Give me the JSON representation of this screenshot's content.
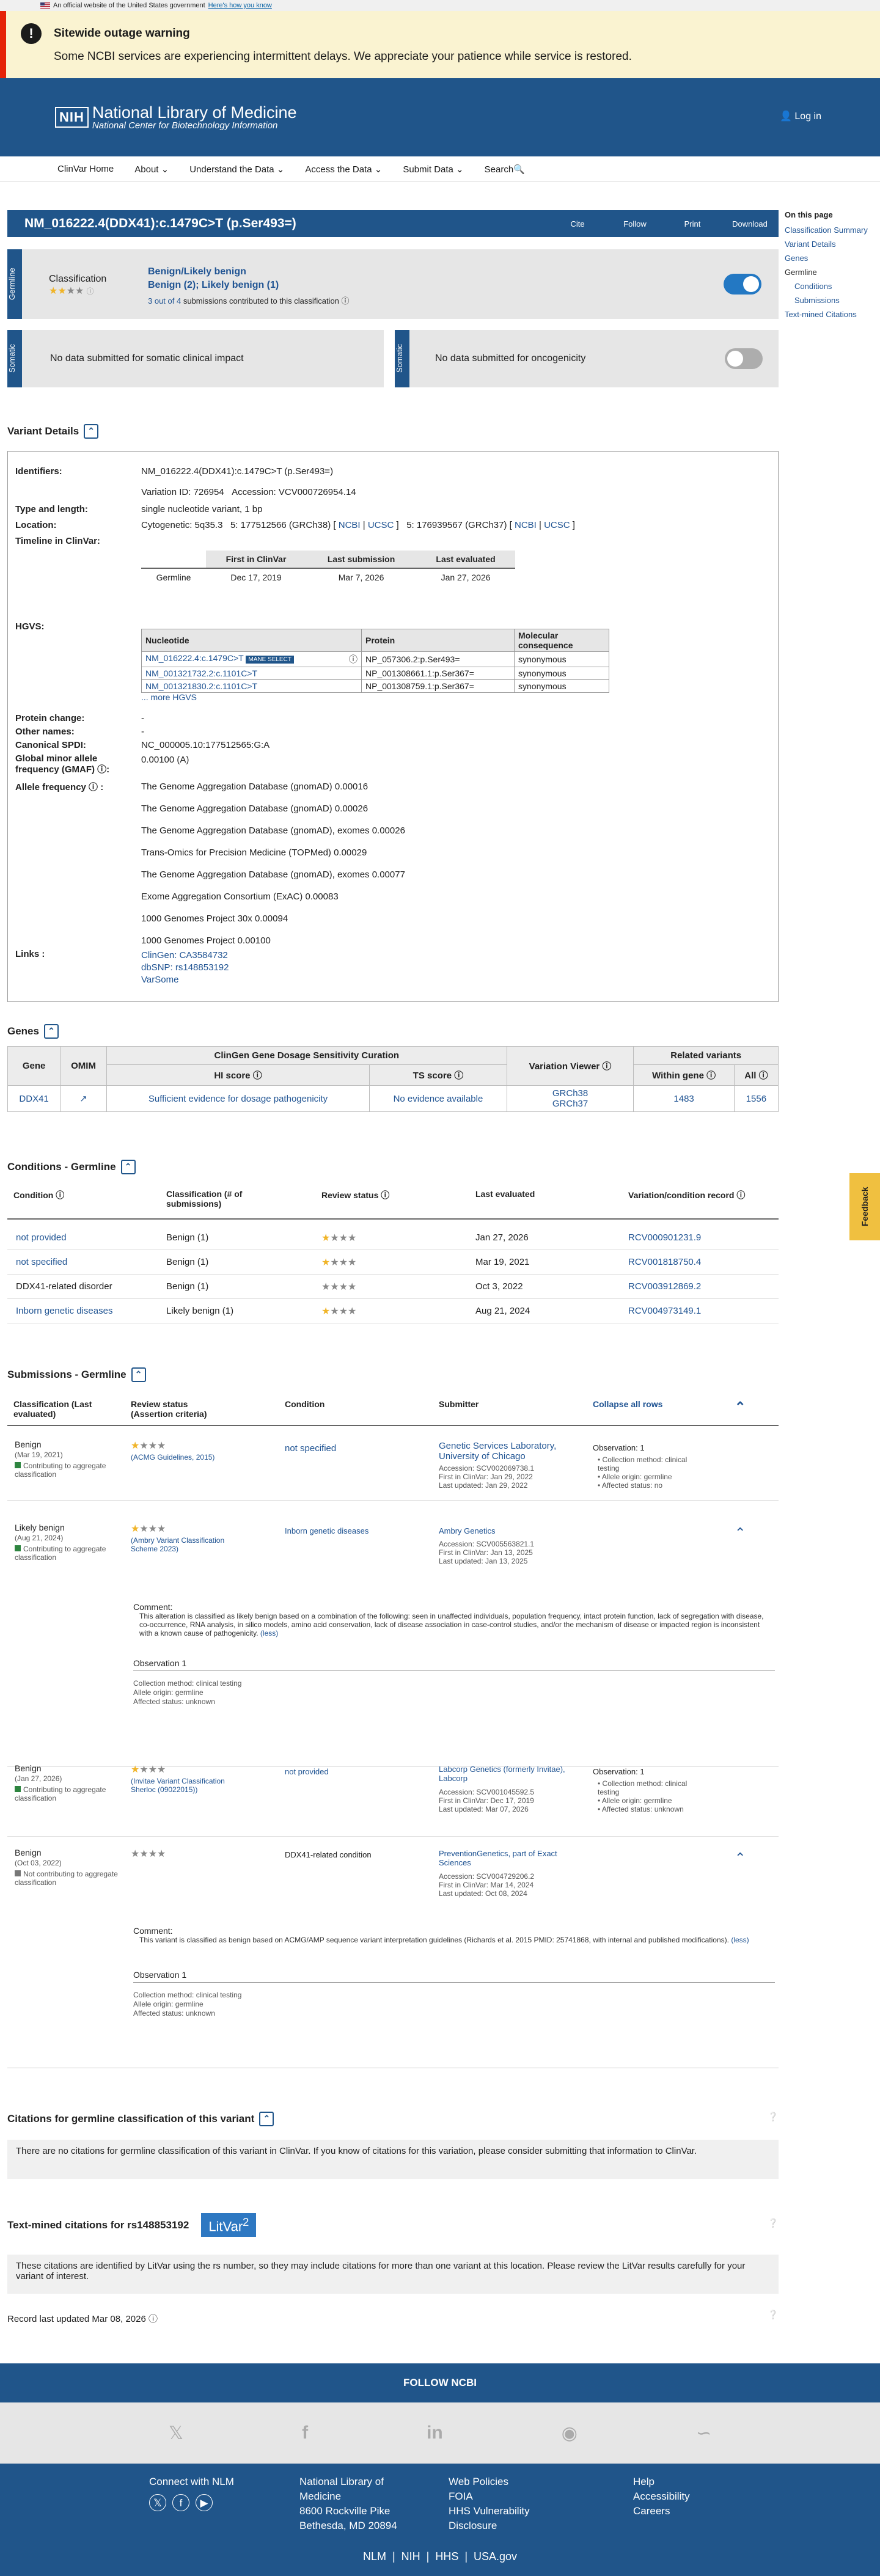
{
  "gov_banner": {
    "text": "An official website of the United States government",
    "link": "Here's how you know"
  },
  "alert": {
    "title": "Sitewide outage warning",
    "body": "Some NCBI services are experiencing intermittent delays. We appreciate your patience while service is restored."
  },
  "header": {
    "logo_abbr": "NIH",
    "title": "National Library of Medicine",
    "subtitle": "National Center for Biotechnology Information",
    "login": "Log in"
  },
  "nav": [
    "ClinVar Home",
    "About",
    "Understand the Data",
    "Access the Data",
    "Submit Data",
    "Search"
  ],
  "variant": {
    "title": "NM_016222.4(DDX41):c.1479C>T (p.Ser493=)",
    "actions": [
      "Cite",
      "Follow",
      "Print",
      "Download"
    ]
  },
  "onthispage": {
    "heading": "On this page",
    "items": [
      "Classification Summary",
      "Variant Details",
      "Genes",
      "Germline",
      "Conditions",
      "Submissions",
      "Text-mined Citations"
    ]
  },
  "germline": {
    "label": "Germline",
    "classification_label": "Classification",
    "class1": "Benign/Likely benign",
    "class2": "Benign (2); Likely benign (1)",
    "submissions_text": "3 out of 4",
    "submissions_rest": "submissions contributed to this classification"
  },
  "somatic": {
    "label": "Somatic",
    "left": "No data submitted for somatic clinical impact",
    "right": "No data submitted for oncogenicity"
  },
  "details": {
    "heading": "Variant Details",
    "labels": {
      "identifiers": "Identifiers:",
      "type": "Type and length:",
      "location": "Location:",
      "timeline": "Timeline in ClinVar:",
      "hgvs": "HGVS:",
      "protein_change": "Protein change:",
      "other_names": "Other names:",
      "spdi": "Canonical SPDI:",
      "gmaf": "Global minor allele frequency (GMAF)",
      "af": "Allele frequency",
      "links": "Links :"
    },
    "identifier": "NM_016222.4(DDX41):c.1479C>T (p.Ser493=)",
    "variation_id": "Variation ID: 726954",
    "accession": "Accession: VCV000726954.14",
    "type": "single nucleotide variant, 1 bp",
    "cytogenetic": "Cytogenetic: 5q35.3",
    "loc38": "5: 177512566 (GRCh38) [",
    "loc37": "5: 176939567 (GRCh37) [",
    "ncbi": "NCBI",
    "ucsc": "UCSC",
    "timeline_headers": [
      "First in ClinVar",
      "Last submission",
      "Last evaluated"
    ],
    "timeline_row": [
      "Germline",
      "Dec 17, 2019",
      "Mar 7, 2026",
      "Jan 27, 2026"
    ],
    "hgvs_headers": [
      "Nucleotide",
      "Protein",
      "Molecular consequence"
    ],
    "hgvs_rows": [
      [
        "NM_016222.4:c.1479C>T",
        "NP_057306.2:p.Ser493=",
        "synonymous"
      ],
      [
        "NM_001321732.2:c.1101C>T",
        "NP_001308661.1:p.Ser367=",
        "synonymous"
      ],
      [
        "NM_001321830.2:c.1101C>T",
        "NP_001308759.1:p.Ser367=",
        "synonymous"
      ]
    ],
    "mane": "MANE SELECT",
    "more_hgvs": "... more HGVS",
    "protein_change": "-",
    "other_names": "-",
    "spdi": "NC_000005.10:177512565:G:A",
    "gmaf": "0.00100 (A)",
    "freqs": [
      "The Genome Aggregation Database (gnomAD) 0.00016",
      "The Genome Aggregation Database (gnomAD) 0.00026",
      "The Genome Aggregation Database (gnomAD), exomes 0.00026",
      "Trans-Omics for Precision Medicine (TOPMed) 0.00029",
      "The Genome Aggregation Database (gnomAD), exomes 0.00077",
      "Exome Aggregation Consortium (ExAC) 0.00083",
      "1000 Genomes Project 30x 0.00094",
      "1000 Genomes Project 0.00100"
    ],
    "links": [
      "ClinGen: CA3584732",
      "dbSNP: rs148853192",
      "VarSome"
    ]
  },
  "genes": {
    "heading": "Genes",
    "headers": {
      "gene": "Gene",
      "omim": "OMIM",
      "clingen": "ClinGen Gene Dosage Sensitivity Curation",
      "hi": "HI score",
      "ts": "TS score",
      "viewer": "Variation Viewer",
      "related": "Related variants",
      "within": "Within gene",
      "all": "All"
    },
    "row": {
      "gene": "DDX41",
      "hi": "Sufficient evidence for dosage pathogenicity",
      "ts": "No evidence available",
      "grch38": "GRCh38",
      "grch37": "GRCh37",
      "within": "1483",
      "all": "1556"
    }
  },
  "conditions": {
    "heading": "Conditions - Germline",
    "headers": [
      "Condition",
      "Classification (# of submissions)",
      "Review status",
      "Last evaluated",
      "Variation/condition record"
    ],
    "rows": [
      [
        "not provided",
        "Benign (1)",
        "Jan 27, 2026",
        "RCV000901231.9"
      ],
      [
        "not specified",
        "Benign (1)",
        "Mar 19, 2021",
        "RCV001818750.4"
      ],
      [
        "DDX41-related disorder",
        "Benign (1)",
        "Oct 3, 2022",
        "RCV003912869.2"
      ],
      [
        "Inborn genetic diseases",
        "Likely benign (1)",
        "Aug 21, 2024",
        "RCV004973149.1"
      ]
    ]
  },
  "submissions": {
    "heading": "Submissions - Germline",
    "headers": [
      "Classification (Last evaluated)",
      "Review status (Assertion criteria)",
      "Condition",
      "Submitter",
      "Collapse all rows"
    ],
    "contrib": "Contributing to aggregate classification",
    "notcontrib": "Not contributing to aggregate classification",
    "s1": {
      "cls": "Benign",
      "date": "(Mar 19, 2021)",
      "crit": "(ACMG Guidelines, 2015)",
      "cond": "not specified",
      "sub": "Genetic Services Laboratory, University of Chicago",
      "acc": "Accession: SCV002069738.1",
      "first": "First in ClinVar: Jan 29, 2022",
      "upd": "Last updated: Jan 29, 2022",
      "obs": "Observation: 1",
      "o1": "Collection method: clinical testing",
      "o2": "Allele origin: germline",
      "o3": "Affected status: no"
    },
    "s2": {
      "cls": "Likely benign",
      "date": "(Aug 21, 2024)",
      "crit": "(Ambry Variant Classification Scheme 2023)",
      "cond": "Inborn genetic diseases",
      "sub": "Ambry Genetics",
      "acc": "Accession: SCV005563821.1",
      "first": "First in ClinVar: Jan 13, 2025",
      "upd": "Last updated: Jan 13, 2025",
      "comment_h": "Comment:",
      "comment": "This alteration is classified as likely benign based on a combination of the following: seen in unaffected individuals, population frequency, intact protein function, lack of segregation with disease, co-occurrence, RNA analysis, in silico models, amino acid conservation, lack of disease association in case-control studies, and/or the mechanism of disease or impacted region is inconsistent with a known cause of pathogenicity.",
      "less": "(less)",
      "obs": "Observation 1",
      "o1": "Collection method: clinical testing",
      "o2": "Allele origin: germline",
      "o3": "Affected status: unknown"
    },
    "s3": {
      "cls": "Benign",
      "date": "(Jan 27, 2026)",
      "crit": "(Invitae Variant Classification Sherloc (09022015))",
      "cond": "not provided",
      "sub": "Labcorp Genetics (formerly Invitae), Labcorp",
      "acc": "Accession: SCV001045592.5",
      "first": "First in ClinVar: Dec 17, 2019",
      "upd": "Last updated: Mar 07, 2026",
      "obs": "Observation: 1",
      "o1": "Collection method: clinical testing",
      "o2": "Allele origin: germline",
      "o3": "Affected status: unknown"
    },
    "s4": {
      "cls": "Benign",
      "date": "(Oct 03, 2022)",
      "cond": "DDX41-related condition",
      "sub": "PreventionGenetics, part of Exact Sciences",
      "acc": "Accession: SCV004729206.2",
      "first": "First in ClinVar: Mar 14, 2024",
      "upd": "Last updated: Oct 08, 2024",
      "comment_h": "Comment:",
      "comment": "This variant is classified as benign based on ACMG/AMP sequence variant interpretation guidelines (Richards et al. 2015 PMID: 25741868, with internal and published modifications).",
      "less": "(less)",
      "obs": "Observation 1",
      "o1": "Collection method: clinical testing",
      "o2": "Allele origin: germline",
      "o3": "Affected status: unknown"
    }
  },
  "citations": {
    "heading": "Citations for germline classification of this variant",
    "text": "There are no citations for germline classification of this variant in ClinVar. If you know of citations for this variation, please consider submitting that information to ClinVar."
  },
  "textmined": {
    "heading": "Text-mined citations for rs148853192",
    "litvar": "LitVar",
    "sup": "2",
    "text": "These citations are identified by LitVar using the rs number, so they may include citations for more than one variant at this location. Please review the LitVar results carefully for your variant of interest."
  },
  "record": "Record last updated Mar 08, 2026",
  "feedback": "Feedback",
  "footer": {
    "follow": "FOLLOW NCBI",
    "connect": "Connect with NLM",
    "address": [
      "National Library of",
      "Medicine",
      "8600 Rockville Pike",
      "Bethesda, MD 20894"
    ],
    "col3": [
      "Web Policies",
      "FOIA",
      "HHS Vulnerability",
      "Disclosure"
    ],
    "col4": [
      "Help",
      "Accessibility",
      "Careers"
    ],
    "bottom": "NLM  |  NIH  |  HHS  |  USA.gov"
  }
}
